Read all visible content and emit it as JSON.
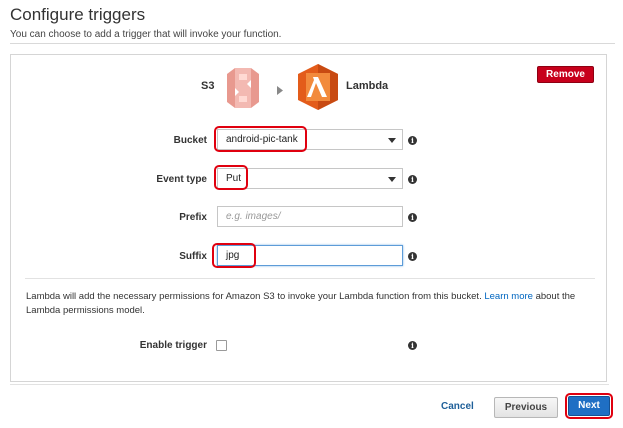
{
  "header": {
    "title": "Configure triggers",
    "subtitle": "You can choose to add a trigger that will invoke your function."
  },
  "trigger": {
    "source_label": "S3",
    "source_icon": "s3-bucket-icon",
    "target_label": "Lambda",
    "target_icon": "lambda-icon",
    "remove_label": "Remove",
    "remove_color": "#c7001b"
  },
  "form": {
    "bucket": {
      "label": "Bucket",
      "value": "android-pic-tank"
    },
    "event_type": {
      "label": "Event type",
      "value": "Put"
    },
    "prefix": {
      "label": "Prefix",
      "value": "",
      "placeholder": "e.g. images/"
    },
    "suffix": {
      "label": "Suffix",
      "value": "jpg"
    }
  },
  "permissions": {
    "text": "Lambda will add the necessary permissions for Amazon S3 to invoke your Lambda function from this bucket.",
    "link_text": "Learn more",
    "text_after": "about the Lambda permissions model."
  },
  "enable_trigger": {
    "label": "Enable trigger",
    "checked": false
  },
  "footer": {
    "cancel_label": "Cancel",
    "previous_label": "Previous",
    "next_label": "Next",
    "next_color": "#1f6fc4"
  },
  "highlight_color": "#e0000f"
}
